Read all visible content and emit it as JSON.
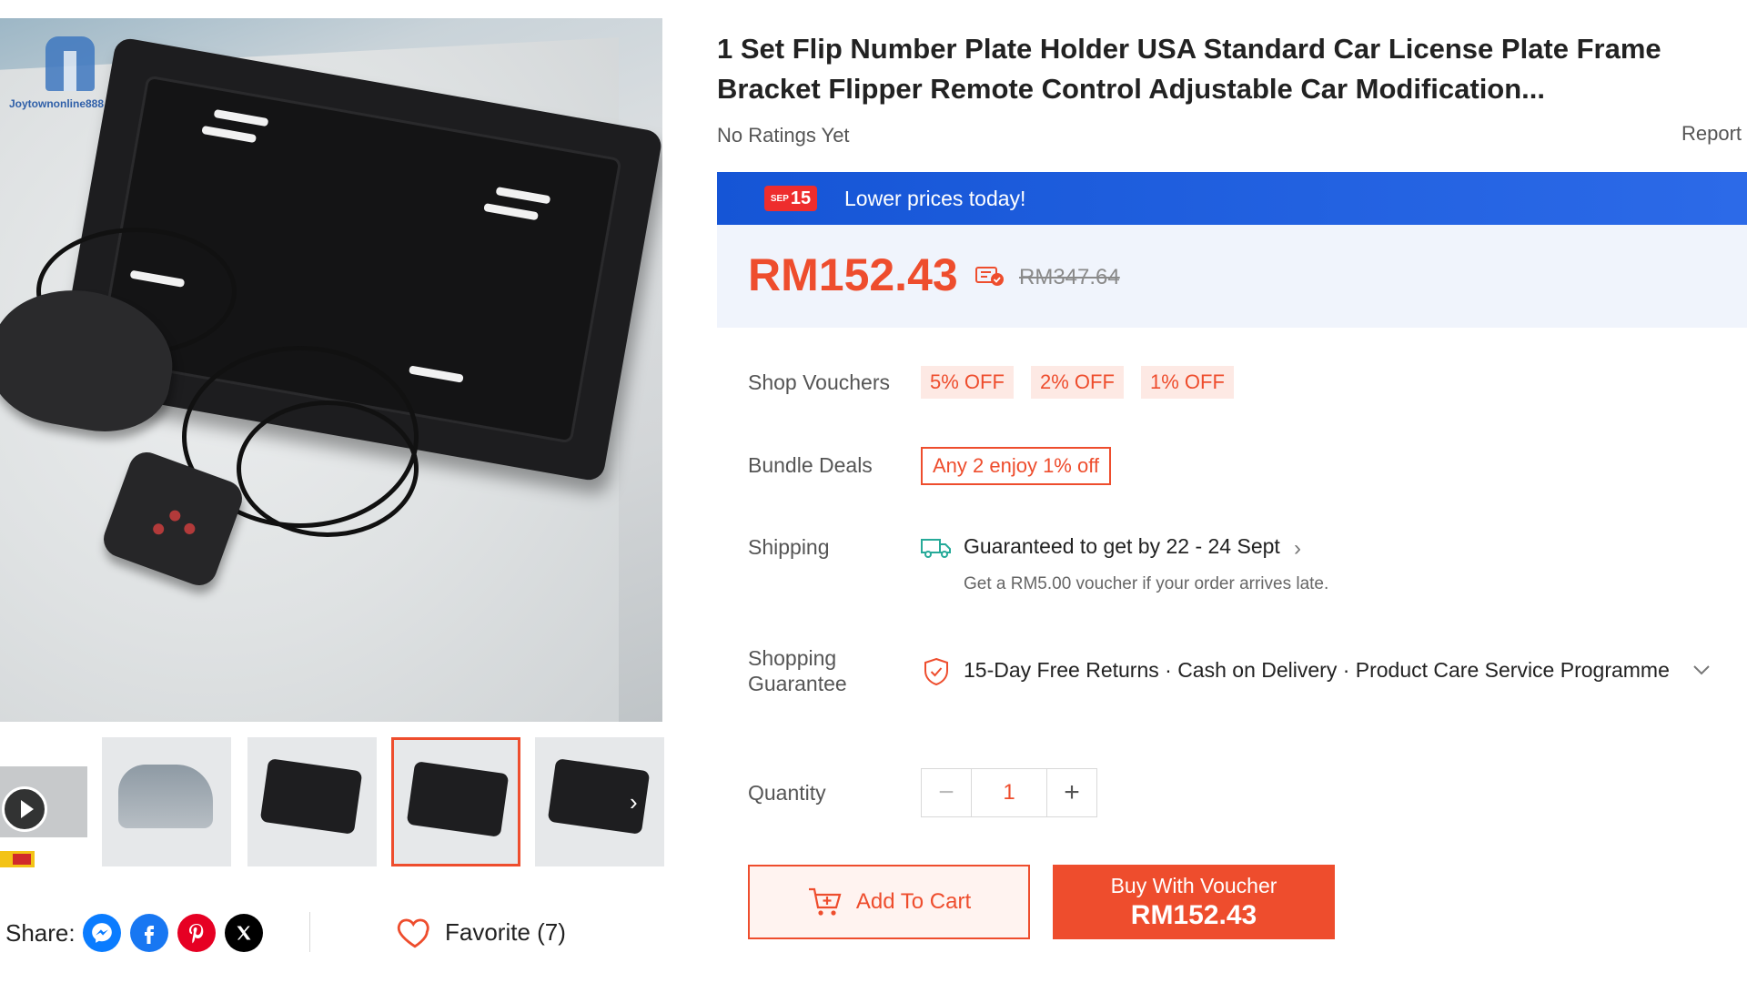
{
  "brand": {
    "watermark": "Joytownonline888"
  },
  "product": {
    "title": "1 Set Flip Number Plate Holder USA Standard Car License Plate Frame Bracket Flipper Remote Control Adjustable Car Modification...",
    "ratings_text": "No Ratings Yet",
    "report_label": "Report"
  },
  "promo": {
    "badge_small": "SEP",
    "badge_big": "15",
    "text": "Lower prices today!",
    "color": "#1f5fe0"
  },
  "price": {
    "current": "RM152.43",
    "original": "RM347.64",
    "accent_color": "#ee4d2d"
  },
  "vouchers": {
    "label": "Shop Vouchers",
    "items": [
      "5% OFF",
      "2% OFF",
      "1% OFF"
    ]
  },
  "bundle": {
    "label": "Bundle Deals",
    "deal": "Any 2 enjoy 1% off"
  },
  "shipping": {
    "label": "Shipping",
    "guarantee": "Guaranteed to get by 22 - 24 Sept",
    "note": "Get a RM5.00 voucher if your order arrives late."
  },
  "guarantee": {
    "label_line1": "Shopping",
    "label_line2": "Guarantee",
    "text": "15-Day Free Returns · Cash on Delivery · Product Care Service Programme"
  },
  "quantity": {
    "label": "Quantity",
    "value": "1",
    "minus": "−",
    "plus": "+"
  },
  "actions": {
    "add_to_cart": "Add To Cart",
    "buy_line1": "Buy With Voucher",
    "buy_line2": "RM152.43"
  },
  "share": {
    "label": "Share:",
    "networks": [
      "messenger",
      "facebook",
      "pinterest",
      "x"
    ]
  },
  "favorite": {
    "text": "Favorite (7)"
  }
}
